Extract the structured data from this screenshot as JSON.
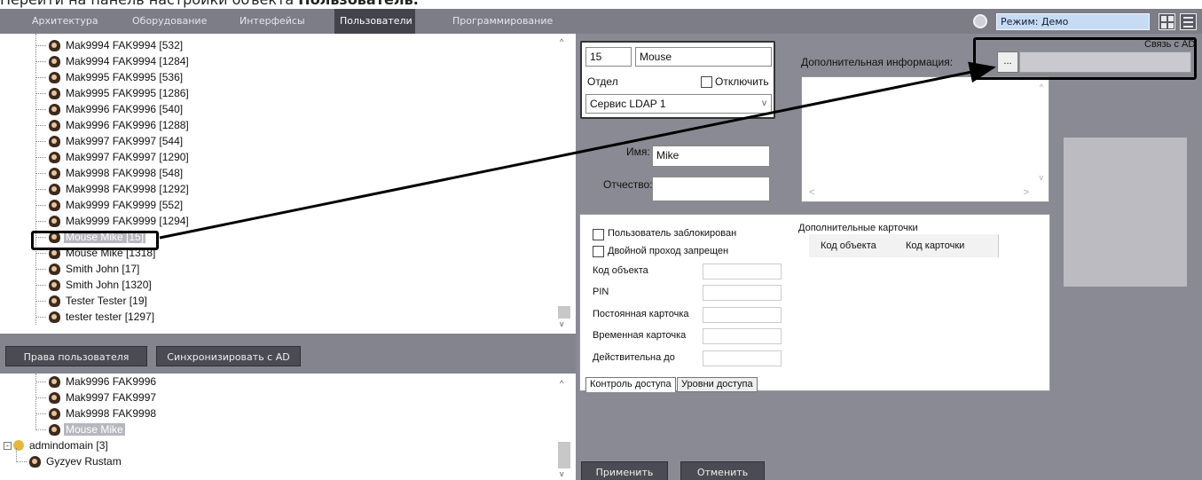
{
  "caption": {
    "prefix": "Перейти на панель настройки объекта ",
    "bold": "Пользователь."
  },
  "menubar": {
    "items": [
      "Архитектура",
      "Оборудование",
      "Интерфейсы",
      "Пользователи",
      "Программирование"
    ],
    "active_index": 3,
    "mode_label": "Режим: Демо"
  },
  "tree_top": [
    "Mak9994 FAK9994  [532]",
    "Mak9994 FAK9994  [1284]",
    "Mak9995 FAK9995  [536]",
    "Mak9995 FAK9995  [1286]",
    "Mak9996 FAK9996  [540]",
    "Mak9996 FAK9996  [1288]",
    "Mak9997 FAK9997  [544]",
    "Mak9997 FAK9997  [1290]",
    "Mak9998 FAK9998  [548]",
    "Mak9998 FAK9998  [1292]",
    "Mak9999 FAK9999  [552]",
    "Mak9999 FAK9999  [1294]",
    "Mouse Mike  [15]",
    "Mouse Mike  [1318]",
    "Smith John  [17]",
    "Smith John  [1320]",
    "Tester Tester  [19]",
    "tester tester  [1297]"
  ],
  "left_buttons": {
    "rights": "Права пользователя",
    "sync": "Синхронизировать с AD"
  },
  "tree_bottom": {
    "users": [
      "Mak9996 FAK9996",
      "Mak9997 FAK9997",
      "Mak9998 FAK9998",
      "Mouse Mike"
    ],
    "domain": "admindomain [3]",
    "domain_user": "Gyzyev Rustam"
  },
  "form": {
    "id": "15",
    "last_name": "Mouse",
    "department_label": "Отдел",
    "disable_label": "Отключить",
    "department_value": "Сервис LDAP 1",
    "first_name_label": "Имя:",
    "first_name": "Mike",
    "patronymic_label": "Отчество:",
    "patronymic": "",
    "extra_info_label": "Дополнительная информация:",
    "ad_link_label": "Связь с AD",
    "ad_button": "...",
    "blocked_label": "Пользователь заблокирован",
    "double_pass_label": "Двойной проход запрещен",
    "object_code_label": "Код объекта",
    "pin_label": "PIN",
    "permanent_card_label": "Постоянная карточка",
    "temp_card_label": "Временная карточка",
    "valid_until_label": "Действительна до",
    "extra_cards_label": "Дополнительные карточки",
    "col_object_code": "Код объекта",
    "col_card_code": "Код карточки",
    "tab_access_control": "Контроль доступа",
    "tab_access_levels": "Уровни доступа",
    "apply": "Применить",
    "cancel": "Отменить"
  }
}
